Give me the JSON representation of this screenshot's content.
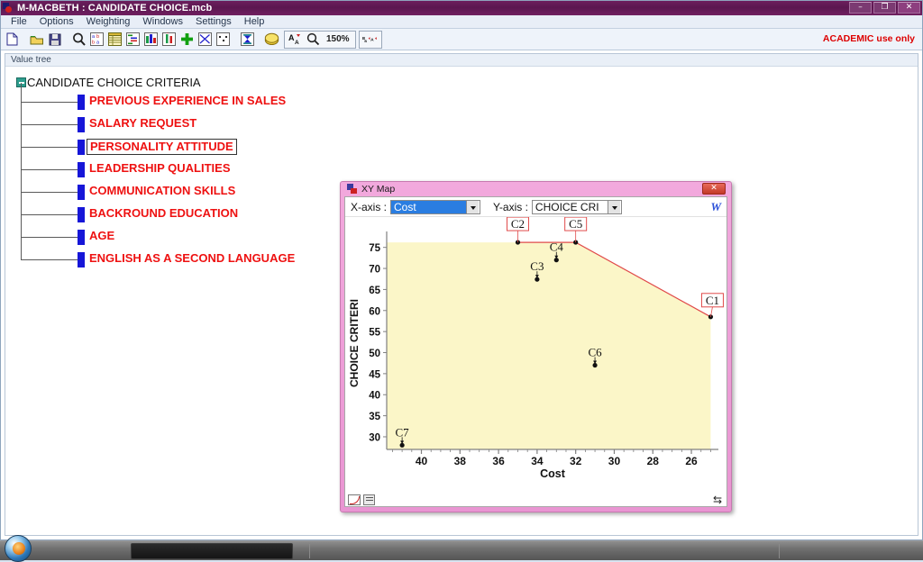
{
  "window": {
    "title": "M-MACBETH : CANDIDATE CHOICE.mcb",
    "app_icon": "macbeth-app-icon",
    "buttons": {
      "minimize": "–",
      "maximize": "❐",
      "close": "✕"
    }
  },
  "menu": {
    "items": [
      {
        "label": "File"
      },
      {
        "label": "Options"
      },
      {
        "label": "Weighting"
      },
      {
        "label": "Windows"
      },
      {
        "label": "Settings"
      },
      {
        "label": "Help"
      }
    ]
  },
  "toolbar": {
    "zoom_level": "150%",
    "academic_notice": "ACADEMIC use only",
    "buttons": [
      {
        "icon": "new-document-icon",
        "name": "new-file-button"
      },
      {
        "icon": "open-folder-icon",
        "name": "open-file-button"
      },
      {
        "icon": "save-disk-icon",
        "name": "save-file-button"
      },
      {
        "icon": "magnifier-icon",
        "name": "view-button"
      },
      {
        "icon": "abc-letters-icon",
        "name": "options-button"
      },
      {
        "icon": "table-icon",
        "name": "table-button"
      },
      {
        "icon": "list-indent-icon",
        "name": "list-button"
      },
      {
        "icon": "bar-chart-icon",
        "name": "bar-chart-button"
      },
      {
        "icon": "thermometer-icon",
        "name": "thermometer-button"
      },
      {
        "icon": "green-plus-icon",
        "name": "add-button"
      },
      {
        "icon": "xy-map-icon",
        "name": "xy-map-button"
      },
      {
        "icon": "scatter-dots-icon",
        "name": "scatter-button"
      },
      {
        "icon": "hourglass-icon",
        "name": "robustness-button"
      },
      {
        "icon": "yellow-coin-icon",
        "name": "cost-button"
      },
      {
        "icon": "font-size-icon",
        "name": "font-button"
      },
      {
        "icon": "zoom-magnifier-icon",
        "name": "zoom-button"
      },
      {
        "icon": "text-color-icon",
        "name": "text-color-button"
      }
    ]
  },
  "value_tree": {
    "panel_header": "Value tree",
    "root": {
      "label": "CANDIDATE CHOICE CRITERIA",
      "expanded": true
    },
    "children": [
      {
        "label": "PREVIOUS EXPERIENCE IN SALES",
        "selected": false
      },
      {
        "label": "SALARY REQUEST",
        "selected": false
      },
      {
        "label": "PERSONALITY ATTITUDE",
        "selected": true
      },
      {
        "label": "LEADERSHIP QUALITIES",
        "selected": false
      },
      {
        "label": "COMMUNICATION SKILLS",
        "selected": false
      },
      {
        "label": "BACKROUND EDUCATION",
        "selected": false
      },
      {
        "label": "AGE",
        "selected": false
      },
      {
        "label": "ENGLISH AS A SECOND LANGUAGE",
        "selected": false
      }
    ]
  },
  "xy_map": {
    "title": "XY Map",
    "close_label": "✕",
    "x_axis_label": "X-axis :",
    "x_axis_value": "Cost",
    "y_axis_label": "Y-axis :",
    "y_axis_value": "CHOICE CRI",
    "w_icon_label": "W",
    "footer": {
      "curve_icon": "curve-toggle-icon",
      "grid_icon": "grid-toggle-icon",
      "swap_icon": "⇆"
    }
  },
  "chart_data": {
    "type": "scatter",
    "title": "",
    "xlabel": "Cost",
    "ylabel": "CHOICE CRITERI",
    "xlim": [
      41.8,
      24.6
    ],
    "ylim": [
      27.0,
      77.5
    ],
    "x_ticks": [
      40,
      38,
      36,
      34,
      32,
      30,
      28,
      26
    ],
    "y_ticks": [
      30,
      35,
      40,
      45,
      50,
      55,
      60,
      65,
      70,
      75
    ],
    "x_axis_reversed": true,
    "grid": false,
    "legend": false,
    "plot_background": "#fbf6c8",
    "frontier_color": "#e04a4a",
    "point_color": "#111111",
    "points": [
      {
        "label": "C1",
        "x": 25.0,
        "y": 58.5,
        "on_frontier": true,
        "boxed_label": true,
        "label_pos": "above-left"
      },
      {
        "label": "C2",
        "x": 35.0,
        "y": 76.2,
        "on_frontier": true,
        "boxed_label": true,
        "label_pos": "above"
      },
      {
        "label": "C3",
        "x": 34.0,
        "y": 67.4,
        "on_frontier": false,
        "boxed_label": false,
        "label_pos": "above"
      },
      {
        "label": "C4",
        "x": 33.0,
        "y": 72.0,
        "on_frontier": false,
        "boxed_label": false,
        "label_pos": "above"
      },
      {
        "label": "C5",
        "x": 32.0,
        "y": 76.2,
        "on_frontier": true,
        "boxed_label": true,
        "label_pos": "above"
      },
      {
        "label": "C6",
        "x": 31.0,
        "y": 47.0,
        "on_frontier": false,
        "boxed_label": false,
        "label_pos": "above"
      },
      {
        "label": "C7",
        "x": 41.0,
        "y": 28.0,
        "on_frontier": false,
        "boxed_label": false,
        "label_pos": "above"
      }
    ],
    "frontier_path": [
      "C2",
      "C5",
      "C1"
    ],
    "shaded_region_note": "pale-yellow dominated area beneath the efficient frontier"
  },
  "taskbar": {
    "start_orb": "windows-start-orb"
  }
}
